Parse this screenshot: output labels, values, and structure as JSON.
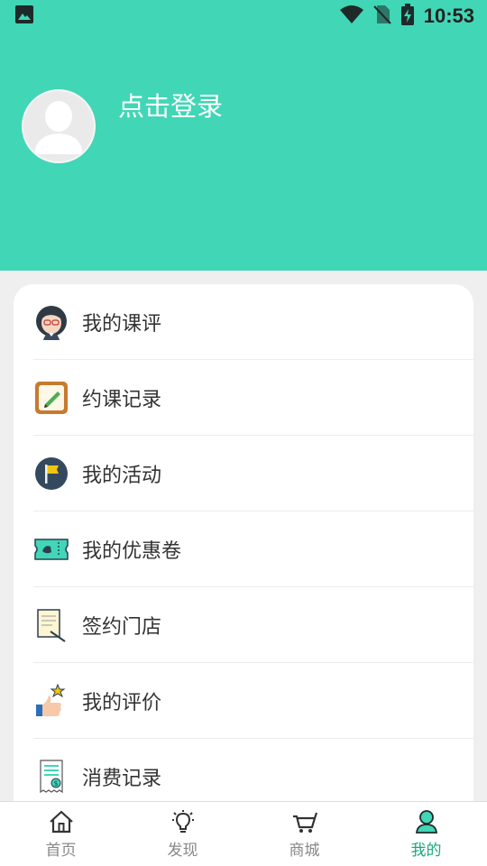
{
  "status_bar": {
    "time": "10:53",
    "icons": [
      "image-icon",
      "wifi-icon",
      "no-sim-icon",
      "battery-charging-icon"
    ]
  },
  "profile": {
    "login_prompt": "点击登录",
    "avatar_icon": "default-avatar-icon"
  },
  "menu": {
    "items": [
      {
        "label": "我的课评",
        "icon": "teacher-avatar-icon"
      },
      {
        "label": "约课记录",
        "icon": "notepad-pencil-icon"
      },
      {
        "label": "我的活动",
        "icon": "flag-icon"
      },
      {
        "label": "我的优惠卷",
        "icon": "coupon-ticket-icon"
      },
      {
        "label": "签约门店",
        "icon": "contract-document-icon"
      },
      {
        "label": "我的评价",
        "icon": "thumbs-up-star-icon"
      },
      {
        "label": "消费记录",
        "icon": "receipt-icon"
      }
    ]
  },
  "tabbar": {
    "tabs": [
      {
        "label": "首页",
        "icon": "home-icon",
        "active": false
      },
      {
        "label": "发现",
        "icon": "lightbulb-icon",
        "active": false
      },
      {
        "label": "商城",
        "icon": "cart-icon",
        "active": false
      },
      {
        "label": "我的",
        "icon": "user-icon",
        "active": true
      }
    ]
  },
  "colors": {
    "header_bg": "#41d6b6",
    "active_tab": "#1aa97f",
    "page_bg": "#efefef"
  }
}
